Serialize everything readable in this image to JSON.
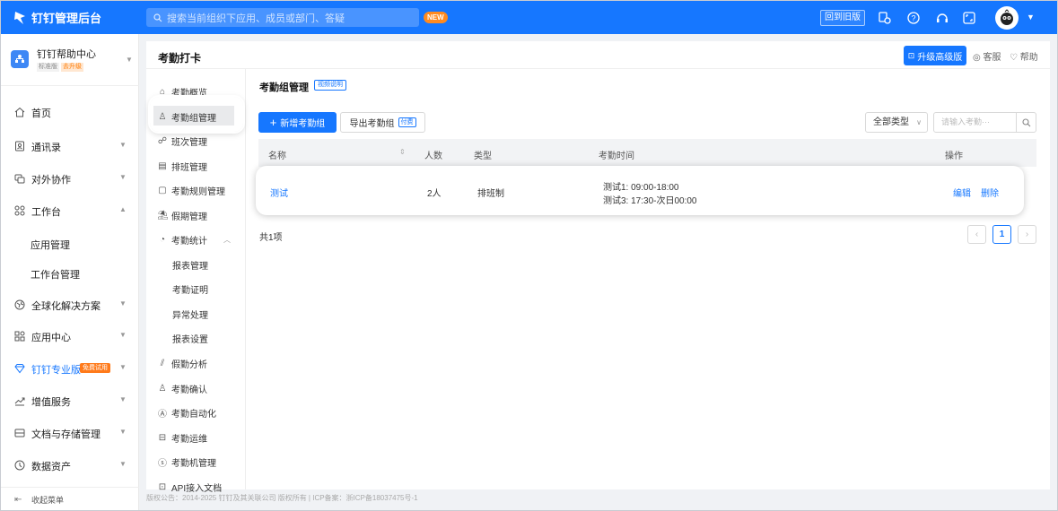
{
  "topbar": {
    "app_title": "钉钉管理后台",
    "search_placeholder": "搜索当前组织下应用、成员或部门、答疑",
    "new_badge": "NEW",
    "old_version_button": "回到旧版"
  },
  "org": {
    "name": "钉钉帮助中心",
    "tier": "标准版",
    "upgrade": "去升级"
  },
  "sidebar": {
    "items": [
      {
        "label": "首页",
        "icon": "home-icon"
      },
      {
        "label": "通讯录",
        "icon": "contacts-icon"
      },
      {
        "label": "对外协作",
        "icon": "collaboration-icon"
      },
      {
        "label": "工作台",
        "icon": "workbench-icon"
      },
      {
        "label": "应用管理"
      },
      {
        "label": "工作台管理"
      },
      {
        "label": "全球化解决方案",
        "icon": "globe-icon"
      },
      {
        "label": "应用中心",
        "icon": "app-center-icon"
      },
      {
        "label": "钉钉专业版",
        "icon": "diamond-icon",
        "badge": "免费试用"
      },
      {
        "label": "增值服务",
        "icon": "trend-icon"
      },
      {
        "label": "文档与存储管理",
        "icon": "storage-icon"
      },
      {
        "label": "数据资产",
        "icon": "data-icon"
      }
    ],
    "collapse_label": "收起菜单"
  },
  "card": {
    "title": "考勤打卡",
    "upgrade_button": "升级高级版",
    "service_label": "客服",
    "help_label": "帮助"
  },
  "subnav": {
    "items": [
      {
        "label": "考勤概览",
        "icon": "overview-icon"
      },
      {
        "label": "考勤组管理",
        "icon": "group-icon"
      },
      {
        "label": "班次管理",
        "icon": "shift-icon"
      },
      {
        "label": "排班管理",
        "icon": "schedule-icon"
      },
      {
        "label": "考勤规则管理",
        "icon": "rules-icon"
      },
      {
        "label": "假期管理",
        "icon": "holiday-icon"
      },
      {
        "label": "考勤统计",
        "icon": "stats-icon"
      },
      {
        "label": "报表管理"
      },
      {
        "label": "考勤证明"
      },
      {
        "label": "异常处理"
      },
      {
        "label": "报表设置"
      },
      {
        "label": "假勤分析",
        "icon": "analysis-icon"
      },
      {
        "label": "考勤确认",
        "icon": "confirm-icon"
      },
      {
        "label": "考勤自动化",
        "icon": "automation-icon"
      },
      {
        "label": "考勤运维",
        "icon": "ops-icon"
      },
      {
        "label": "考勤机管理",
        "icon": "machine-icon"
      },
      {
        "label": "API接入文档",
        "icon": "api-icon"
      }
    ]
  },
  "main": {
    "title": "考勤组管理",
    "video_badge": "视频说明",
    "add_button": "新增考勤组",
    "export_button": "导出考勤组",
    "paid_badge": "付费",
    "type_select": "全部类型",
    "search_placeholder": "请输入考勤···",
    "columns": [
      "名称",
      "人数",
      "类型",
      "考勤时间",
      "操作"
    ],
    "row": {
      "name": "测试",
      "count": "2人",
      "type": "排班制",
      "time1": "测试1: 09:00-18:00",
      "time2": "测试3: 17:30-次日00:00",
      "edit": "编辑",
      "delete": "删除"
    },
    "total": "共1项",
    "current_page": "1"
  },
  "footer": "版权公告：2014-2025 钉钉及其关联公司 版权所有 | ICP备案：浙ICP备18037475号-1",
  "colors": {
    "brand": "#1677ff",
    "upgrade": "#ff7a1a"
  }
}
